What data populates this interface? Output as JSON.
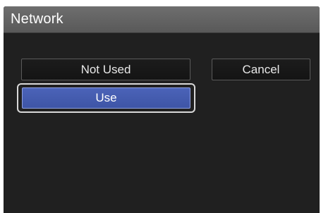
{
  "dialog": {
    "title": "Network"
  },
  "buttons": {
    "not_used_label": "Not Used",
    "cancel_label": "Cancel",
    "use_label": "Use"
  },
  "colors": {
    "titlebar": "#626262",
    "background": "#202020",
    "selected_button": "#4259ac",
    "focus_ring": "#d8d8d8"
  },
  "state": {
    "focused_button": "Use"
  }
}
